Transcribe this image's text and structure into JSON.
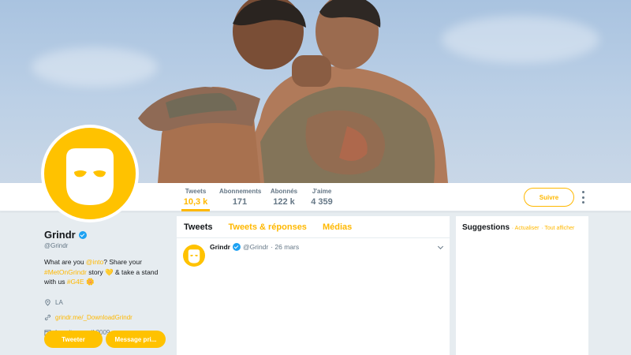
{
  "colors": {
    "accent": "#ffb800",
    "avatar_bg": "#ffc200",
    "verified": "#1da1f2",
    "page_bg": "#e6ecf0"
  },
  "nav": {
    "stats": [
      {
        "label": "Tweets",
        "value": "10,3 k"
      },
      {
        "label": "Abonnements",
        "value": "171"
      },
      {
        "label": "Abonnés",
        "value": "122 k"
      },
      {
        "label": "J'aime",
        "value": "4 359"
      }
    ],
    "follow_label": "Suivre"
  },
  "profile": {
    "name": "Grindr",
    "handle": "@Grindr",
    "bio": {
      "p1": "What are you ",
      "mention": "@into",
      "p2": "? Share your ",
      "hashtag1": "#MetOnGrindr",
      "p3": " story ",
      "emoji1": "💛",
      "p4": " & take a stand with us ",
      "hashtag2": "#G4E",
      "emoji2": "🌼"
    },
    "location": "LA",
    "website": "grindr.me/_DownloadGrindr",
    "joined": "Inscrit en avril 2009",
    "tweet_button": "Tweeter",
    "message_button": "Message pri..."
  },
  "timeline": {
    "tabs": [
      "Tweets",
      "Tweets & réponses",
      "Médias"
    ],
    "tweet": {
      "name": "Grindr",
      "handle": "@Grindr",
      "date": "· 26 mars"
    }
  },
  "suggestions": {
    "title": "Suggestions",
    "refresh": "· Actualiser",
    "view_all": "· Tout afficher"
  }
}
